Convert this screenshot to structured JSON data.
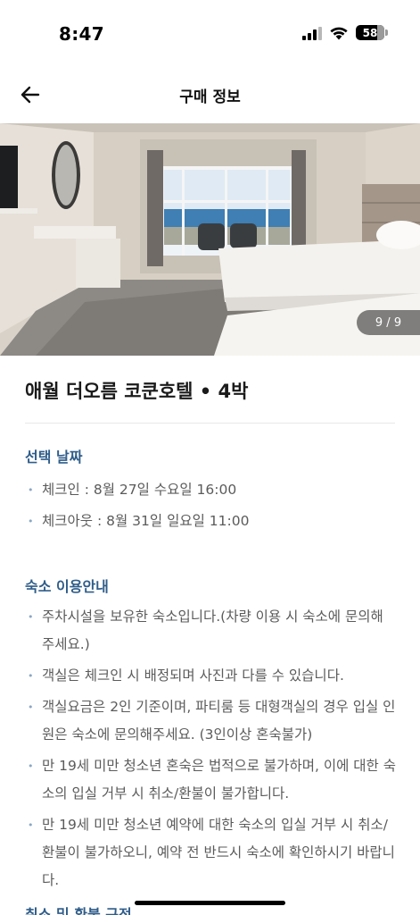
{
  "status_bar": {
    "time": "8:47",
    "battery": "58",
    "icons": [
      "signal-icon",
      "wifi-icon",
      "battery-icon"
    ]
  },
  "nav": {
    "back_icon": "arrow-left-icon",
    "title": "구매 정보"
  },
  "hero": {
    "image_counter": "9 / 9"
  },
  "hotel": {
    "title": "애월 더오름 코쿤호텔 • 4박"
  },
  "dates_section": {
    "title": "선택 날짜",
    "items": [
      "체크인 : 8월 27일 수요일 16:00",
      "체크아웃 : 8월 31일 일요일 11:00"
    ]
  },
  "notice_section": {
    "title": "숙소 이용안내",
    "items": [
      "주차시설을 보유한 숙소입니다.(차량 이용 시 숙소에 문의해 주세요.)",
      "객실은 체크인 시 배정되며 사진과 다를 수 있습니다.",
      "객실요금은 2인 기준이며, 파티룸 등 대형객실의 경우 입실 인원은 숙소에 문의해주세요. (3인이상 혼숙불가)",
      "만 19세 미만 청소년 혼숙은 법적으로 불가하며, 이에 대한 숙소의 입실 거부 시 취소/환불이 불가합니다.",
      "만 19세 미만 청소년 예약에 대한 숙소의 입실 거부 시 취소/환불이 불가하오니, 예약 전 반드시 숙소에 확인하시기 바랍니다."
    ]
  },
  "refund_section": {
    "title": "취소 및 환불 규정"
  },
  "colors": {
    "section_title": "#2f5d8a",
    "body_text": "#5b5b5b",
    "bullet": "#8aa7c4"
  }
}
